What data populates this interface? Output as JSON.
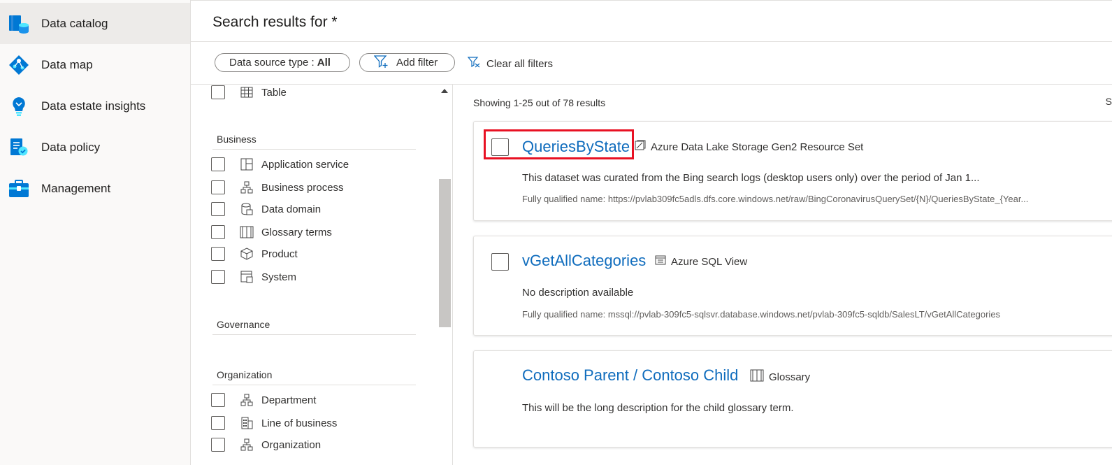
{
  "nav": {
    "items": [
      {
        "label": "Data catalog",
        "icon": "data-catalog-icon",
        "active": true
      },
      {
        "label": "Data map",
        "icon": "data-map-icon",
        "active": false
      },
      {
        "label": "Data estate insights",
        "icon": "insights-icon",
        "active": false
      },
      {
        "label": "Data policy",
        "icon": "data-policy-icon",
        "active": false
      },
      {
        "label": "Management",
        "icon": "management-icon",
        "active": false
      }
    ]
  },
  "header": {
    "title": "Search results for *"
  },
  "filters": {
    "datasource_label": "Data source type :",
    "datasource_value": "All",
    "add_filter": "Add filter",
    "clear_all": "Clear all filters"
  },
  "facets": {
    "top_item": {
      "label": "Table",
      "icon": "table-icon"
    },
    "groups": [
      {
        "title": "Business",
        "items": [
          {
            "label": "Application service",
            "icon": "application-service-icon"
          },
          {
            "label": "Business process",
            "icon": "business-process-icon"
          },
          {
            "label": "Data domain",
            "icon": "data-domain-icon"
          },
          {
            "label": "Glossary terms",
            "icon": "glossary-icon"
          },
          {
            "label": "Product",
            "icon": "product-icon"
          },
          {
            "label": "System",
            "icon": "system-icon"
          }
        ]
      },
      {
        "title": "Governance",
        "items": []
      },
      {
        "title": "Organization",
        "items": [
          {
            "label": "Department",
            "icon": "department-icon"
          },
          {
            "label": "Line of business",
            "icon": "line-of-business-icon"
          },
          {
            "label": "Organization",
            "icon": "organization-icon"
          }
        ]
      }
    ]
  },
  "results": {
    "count_text": "Showing 1-25 out of 78 results",
    "edge_glyph": "S",
    "items": [
      {
        "title": "QueriesByState",
        "type": "Azure Data Lake Storage Gen2 Resource Set",
        "type_icon": "resource-set-icon",
        "description": "This dataset was curated from the Bing search logs (desktop users only) over the period of Jan 1...",
        "fqn": "Fully qualified name: https://pvlab309fc5adls.dfs.core.windows.net/raw/BingCoronavirusQuerySet/{N}/QueriesByState_{Year..."
      },
      {
        "title": "vGetAllCategories",
        "type": "Azure SQL View",
        "type_icon": "sql-view-icon",
        "description": "No description available",
        "fqn": "Fully qualified name: mssql://pvlab-309fc5-sqlsvr.database.windows.net/pvlab-309fc5-sqldb/SalesLT/vGetAllCategories"
      },
      {
        "title": "Contoso Parent / Contoso Child",
        "type": "Glossary",
        "type_icon": "glossary-icon",
        "description": "This will be the long description for the child glossary term."
      }
    ]
  },
  "colors": {
    "link": "#0f6cbd",
    "highlight": "#e81123",
    "nav_active": "#edebe9",
    "icon_blue": "#0078d4"
  }
}
